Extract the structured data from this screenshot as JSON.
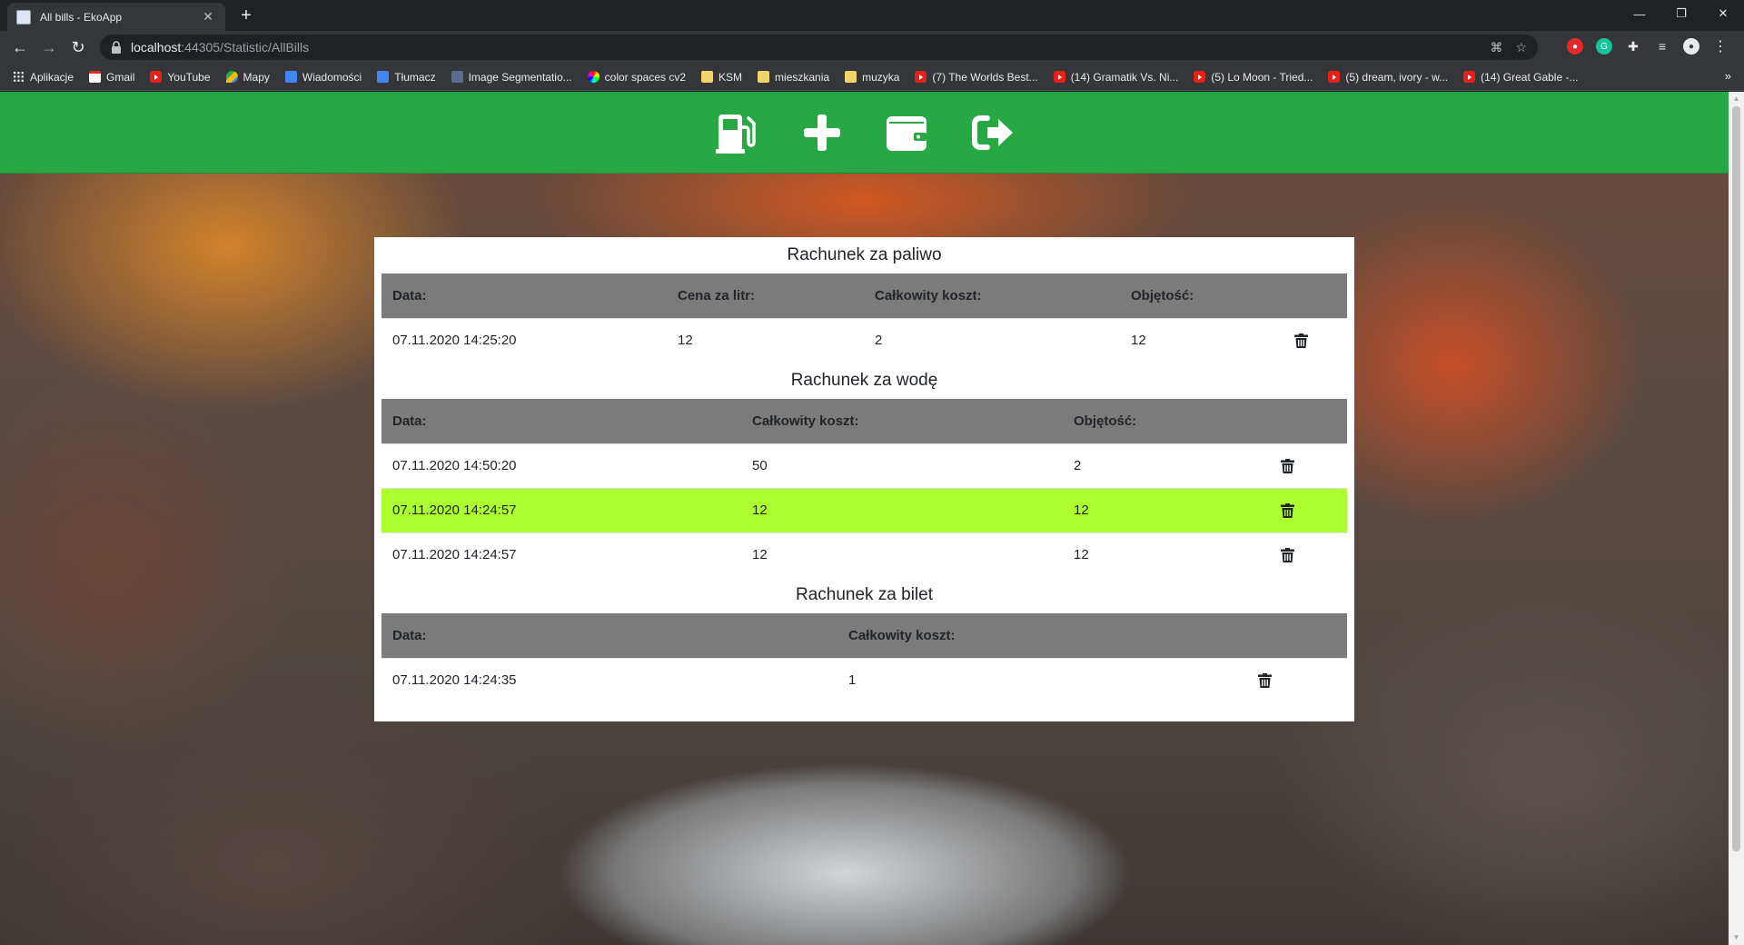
{
  "browser": {
    "tab_title": "All bills - EkoApp",
    "url_host": "localhost",
    "url_rest": ":44305/Statistic/AllBills"
  },
  "bookmarks": [
    {
      "label": "Aplikacje",
      "icon": "apps"
    },
    {
      "label": "Gmail",
      "icon": "gmail"
    },
    {
      "label": "YouTube",
      "icon": "yt"
    },
    {
      "label": "Mapy",
      "icon": "maps"
    },
    {
      "label": "Wiadomości",
      "icon": "gnews"
    },
    {
      "label": "Tłumacz",
      "icon": "gtrans"
    },
    {
      "label": "Image Segmentatio...",
      "icon": "seg"
    },
    {
      "label": "color spaces cv2",
      "icon": "cs"
    },
    {
      "label": "KSM",
      "icon": "folder"
    },
    {
      "label": "mieszkania",
      "icon": "folder"
    },
    {
      "label": "muzyka",
      "icon": "folder"
    },
    {
      "label": "(7) The Worlds Best...",
      "icon": "yt"
    },
    {
      "label": "(14) Gramatik Vs. Ni...",
      "icon": "yt"
    },
    {
      "label": "(5) Lo Moon - Tried...",
      "icon": "yt"
    },
    {
      "label": "(5) dream, ivory - w...",
      "icon": "yt"
    },
    {
      "label": "(14) Great Gable -...",
      "icon": "yt"
    }
  ],
  "navbar": {
    "color": "#28a745",
    "icons": [
      "gas-pump-icon",
      "plus-icon",
      "wallet-icon",
      "sign-out-icon"
    ]
  },
  "fuel": {
    "title": "Rachunek za paliwo",
    "headers": [
      "Data:",
      "Cena za litr:",
      "Całkowity koszt:",
      "Objętość:"
    ],
    "rows": [
      {
        "date": "07.11.2020 14:25:20",
        "price": "12",
        "total": "2",
        "volume": "12"
      }
    ]
  },
  "water": {
    "title": "Rachunek za wodę",
    "headers": [
      "Data:",
      "Całkowity koszt:",
      "Objętość:"
    ],
    "rows": [
      {
        "date": "07.11.2020 14:50:20",
        "total": "50",
        "volume": "2"
      },
      {
        "date": "07.11.2020 14:24:57",
        "total": "12",
        "volume": "12"
      },
      {
        "date": "07.11.2020 14:24:57",
        "total": "12",
        "volume": "12"
      }
    ],
    "highlight_color": "#adff2f"
  },
  "ticket": {
    "title": "Rachunek za bilet",
    "headers": [
      "Data:",
      "Całkowity koszt:"
    ],
    "rows": [
      {
        "date": "07.11.2020 14:24:35",
        "total": "1"
      }
    ]
  }
}
